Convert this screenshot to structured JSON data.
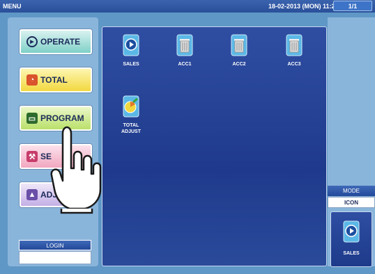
{
  "topbar": {
    "title": "MENU",
    "datetime": "18-02-2013 (MON) 11:20",
    "page": "1/1"
  },
  "menu": {
    "operate": "OPERATE",
    "total": "TOTAL",
    "program": "PROGRAM",
    "setup": "SE",
    "adjust": "ADJ"
  },
  "login": {
    "label": "LOGIN",
    "value": ""
  },
  "tiles": [
    {
      "label": "SALES",
      "icon": "sales-icon"
    },
    {
      "label": "ACC1",
      "icon": "trash-icon"
    },
    {
      "label": "ACC2",
      "icon": "trash-icon"
    },
    {
      "label": "ACC3",
      "icon": "trash-icon"
    },
    {
      "label": "TOTAL ADJUST",
      "icon": "total-adjust-icon"
    }
  ],
  "mode": {
    "label": "MODE",
    "value": "ICON"
  },
  "quick": {
    "label": "SALES"
  },
  "colors": {
    "topbar": "#2a4f9a",
    "panel_bg": "#1f3a8c",
    "background": "#5f97c6"
  }
}
